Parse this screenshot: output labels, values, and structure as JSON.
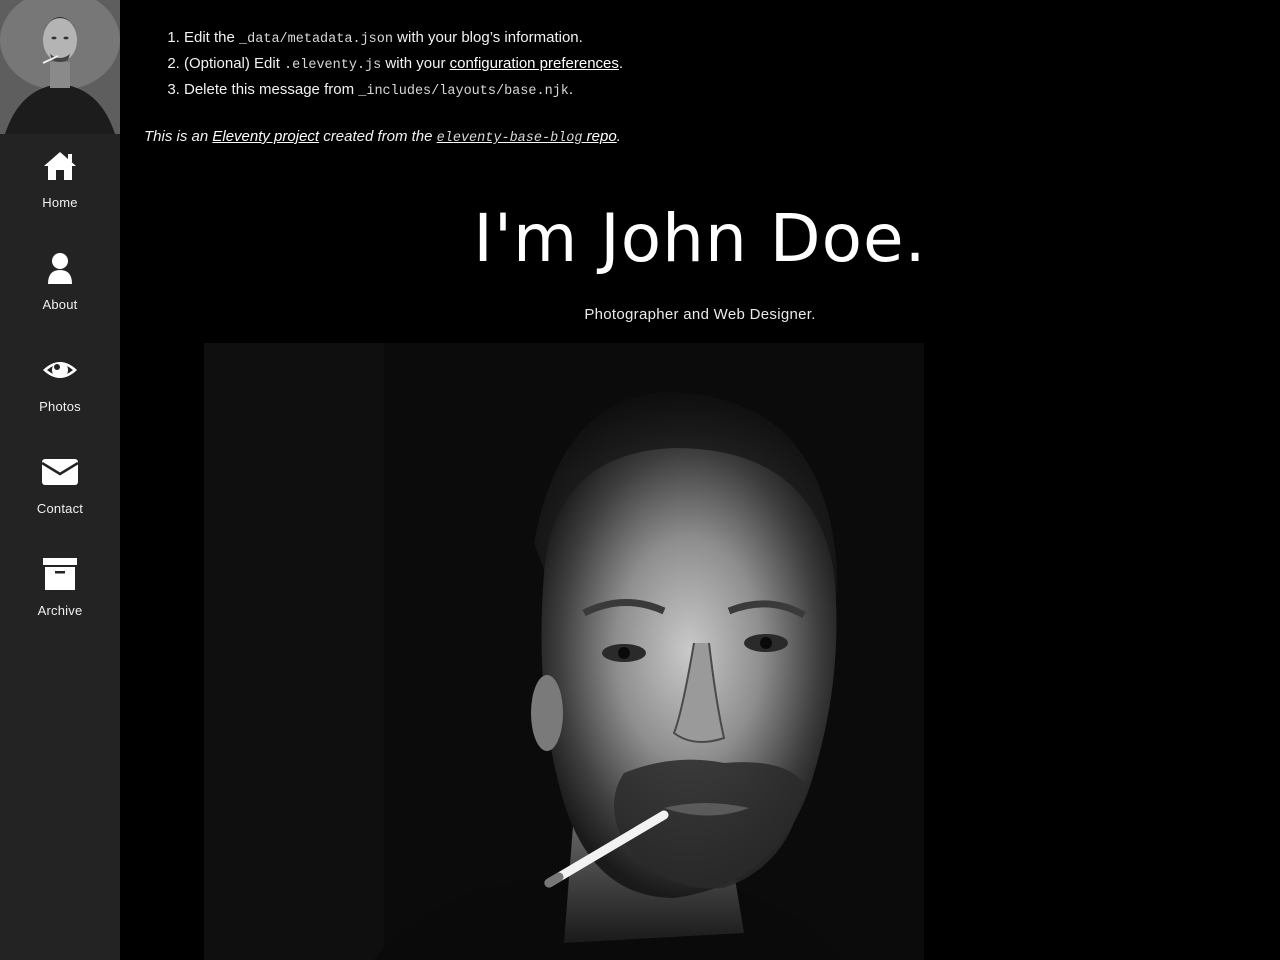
{
  "sidebar": {
    "avatar_alt": "John Doe",
    "items": [
      {
        "label": "Home",
        "icon": "home-icon"
      },
      {
        "label": "About",
        "icon": "user-icon"
      },
      {
        "label": "Photos",
        "icon": "eye-icon"
      },
      {
        "label": "Contact",
        "icon": "envelope-icon"
      },
      {
        "label": "Archive",
        "icon": "archive-icon"
      }
    ]
  },
  "setup_steps": [
    {
      "before": "Edit the ",
      "code": "_data/metadata.json",
      "after": " with your blog’s information."
    },
    {
      "before": "(Optional) Edit ",
      "code": ".eleventy.js",
      "middle": " with your ",
      "link": "configuration preferences",
      "after": "."
    },
    {
      "before": "Delete this message from ",
      "code": "_includes/layouts/base.njk",
      "after": "."
    }
  ],
  "note": {
    "before": "This is an ",
    "link1": "Eleventy project",
    "middle": " created from the ",
    "link2_code": "eleventy-base-blog",
    "link2_text": " repo",
    "after": "."
  },
  "hero": {
    "title": "I'm John Doe.",
    "subtitle": "Photographer and Web Designer."
  },
  "colors": {
    "sidebar_bg": "#232323",
    "main_bg": "#000000",
    "text": "#ffffff"
  }
}
